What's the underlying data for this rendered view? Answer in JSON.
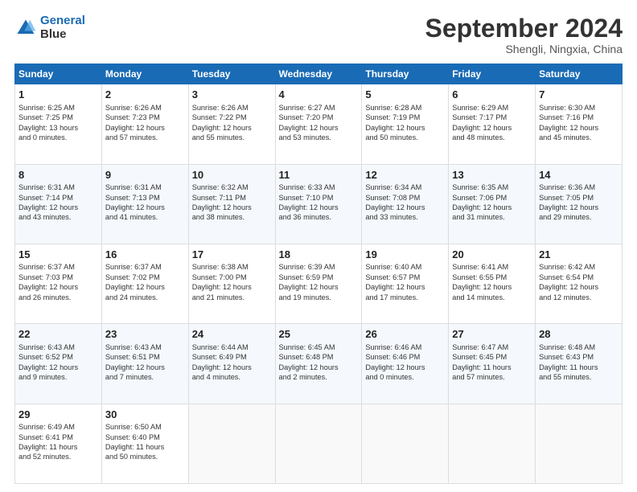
{
  "header": {
    "logo_line1": "General",
    "logo_line2": "Blue",
    "month": "September 2024",
    "location": "Shengli, Ningxia, China"
  },
  "days_of_week": [
    "Sunday",
    "Monday",
    "Tuesday",
    "Wednesday",
    "Thursday",
    "Friday",
    "Saturday"
  ],
  "weeks": [
    [
      {
        "day": "1",
        "info": "Sunrise: 6:25 AM\nSunset: 7:25 PM\nDaylight: 13 hours\nand 0 minutes."
      },
      {
        "day": "2",
        "info": "Sunrise: 6:26 AM\nSunset: 7:23 PM\nDaylight: 12 hours\nand 57 minutes."
      },
      {
        "day": "3",
        "info": "Sunrise: 6:26 AM\nSunset: 7:22 PM\nDaylight: 12 hours\nand 55 minutes."
      },
      {
        "day": "4",
        "info": "Sunrise: 6:27 AM\nSunset: 7:20 PM\nDaylight: 12 hours\nand 53 minutes."
      },
      {
        "day": "5",
        "info": "Sunrise: 6:28 AM\nSunset: 7:19 PM\nDaylight: 12 hours\nand 50 minutes."
      },
      {
        "day": "6",
        "info": "Sunrise: 6:29 AM\nSunset: 7:17 PM\nDaylight: 12 hours\nand 48 minutes."
      },
      {
        "day": "7",
        "info": "Sunrise: 6:30 AM\nSunset: 7:16 PM\nDaylight: 12 hours\nand 45 minutes."
      }
    ],
    [
      {
        "day": "8",
        "info": "Sunrise: 6:31 AM\nSunset: 7:14 PM\nDaylight: 12 hours\nand 43 minutes."
      },
      {
        "day": "9",
        "info": "Sunrise: 6:31 AM\nSunset: 7:13 PM\nDaylight: 12 hours\nand 41 minutes."
      },
      {
        "day": "10",
        "info": "Sunrise: 6:32 AM\nSunset: 7:11 PM\nDaylight: 12 hours\nand 38 minutes."
      },
      {
        "day": "11",
        "info": "Sunrise: 6:33 AM\nSunset: 7:10 PM\nDaylight: 12 hours\nand 36 minutes."
      },
      {
        "day": "12",
        "info": "Sunrise: 6:34 AM\nSunset: 7:08 PM\nDaylight: 12 hours\nand 33 minutes."
      },
      {
        "day": "13",
        "info": "Sunrise: 6:35 AM\nSunset: 7:06 PM\nDaylight: 12 hours\nand 31 minutes."
      },
      {
        "day": "14",
        "info": "Sunrise: 6:36 AM\nSunset: 7:05 PM\nDaylight: 12 hours\nand 29 minutes."
      }
    ],
    [
      {
        "day": "15",
        "info": "Sunrise: 6:37 AM\nSunset: 7:03 PM\nDaylight: 12 hours\nand 26 minutes."
      },
      {
        "day": "16",
        "info": "Sunrise: 6:37 AM\nSunset: 7:02 PM\nDaylight: 12 hours\nand 24 minutes."
      },
      {
        "day": "17",
        "info": "Sunrise: 6:38 AM\nSunset: 7:00 PM\nDaylight: 12 hours\nand 21 minutes."
      },
      {
        "day": "18",
        "info": "Sunrise: 6:39 AM\nSunset: 6:59 PM\nDaylight: 12 hours\nand 19 minutes."
      },
      {
        "day": "19",
        "info": "Sunrise: 6:40 AM\nSunset: 6:57 PM\nDaylight: 12 hours\nand 17 minutes."
      },
      {
        "day": "20",
        "info": "Sunrise: 6:41 AM\nSunset: 6:55 PM\nDaylight: 12 hours\nand 14 minutes."
      },
      {
        "day": "21",
        "info": "Sunrise: 6:42 AM\nSunset: 6:54 PM\nDaylight: 12 hours\nand 12 minutes."
      }
    ],
    [
      {
        "day": "22",
        "info": "Sunrise: 6:43 AM\nSunset: 6:52 PM\nDaylight: 12 hours\nand 9 minutes."
      },
      {
        "day": "23",
        "info": "Sunrise: 6:43 AM\nSunset: 6:51 PM\nDaylight: 12 hours\nand 7 minutes."
      },
      {
        "day": "24",
        "info": "Sunrise: 6:44 AM\nSunset: 6:49 PM\nDaylight: 12 hours\nand 4 minutes."
      },
      {
        "day": "25",
        "info": "Sunrise: 6:45 AM\nSunset: 6:48 PM\nDaylight: 12 hours\nand 2 minutes."
      },
      {
        "day": "26",
        "info": "Sunrise: 6:46 AM\nSunset: 6:46 PM\nDaylight: 12 hours\nand 0 minutes."
      },
      {
        "day": "27",
        "info": "Sunrise: 6:47 AM\nSunset: 6:45 PM\nDaylight: 11 hours\nand 57 minutes."
      },
      {
        "day": "28",
        "info": "Sunrise: 6:48 AM\nSunset: 6:43 PM\nDaylight: 11 hours\nand 55 minutes."
      }
    ],
    [
      {
        "day": "29",
        "info": "Sunrise: 6:49 AM\nSunset: 6:41 PM\nDaylight: 11 hours\nand 52 minutes."
      },
      {
        "day": "30",
        "info": "Sunrise: 6:50 AM\nSunset: 6:40 PM\nDaylight: 11 hours\nand 50 minutes."
      },
      {
        "day": "",
        "info": ""
      },
      {
        "day": "",
        "info": ""
      },
      {
        "day": "",
        "info": ""
      },
      {
        "day": "",
        "info": ""
      },
      {
        "day": "",
        "info": ""
      }
    ]
  ]
}
